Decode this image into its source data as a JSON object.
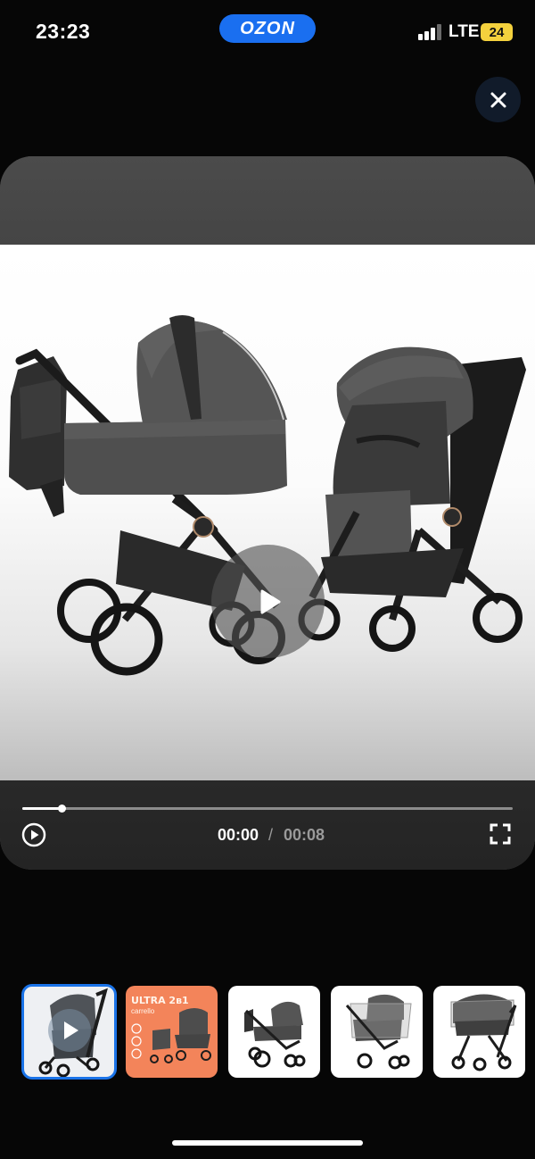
{
  "status_bar": {
    "time": "23:23",
    "network": "LTE",
    "battery": "24"
  },
  "brand": {
    "name": "OZON",
    "color": "#1a6ff0"
  },
  "close_icon": "close-icon",
  "player": {
    "current_time": "00:00",
    "separator": "/",
    "duration": "00:08",
    "progress": 0.08,
    "play_icon": "play-icon",
    "fullscreen_icon": "fullscreen-icon"
  },
  "thumbnails": [
    {
      "kind": "video",
      "active": true
    },
    {
      "kind": "promo",
      "title": "ULTRA 2в1",
      "subtitle": "carrello"
    },
    {
      "kind": "image"
    },
    {
      "kind": "image"
    },
    {
      "kind": "image"
    }
  ],
  "colors": {
    "accent": "#1a73e8",
    "promo_bg": "#f3845a",
    "battery": "#f4d13d"
  }
}
